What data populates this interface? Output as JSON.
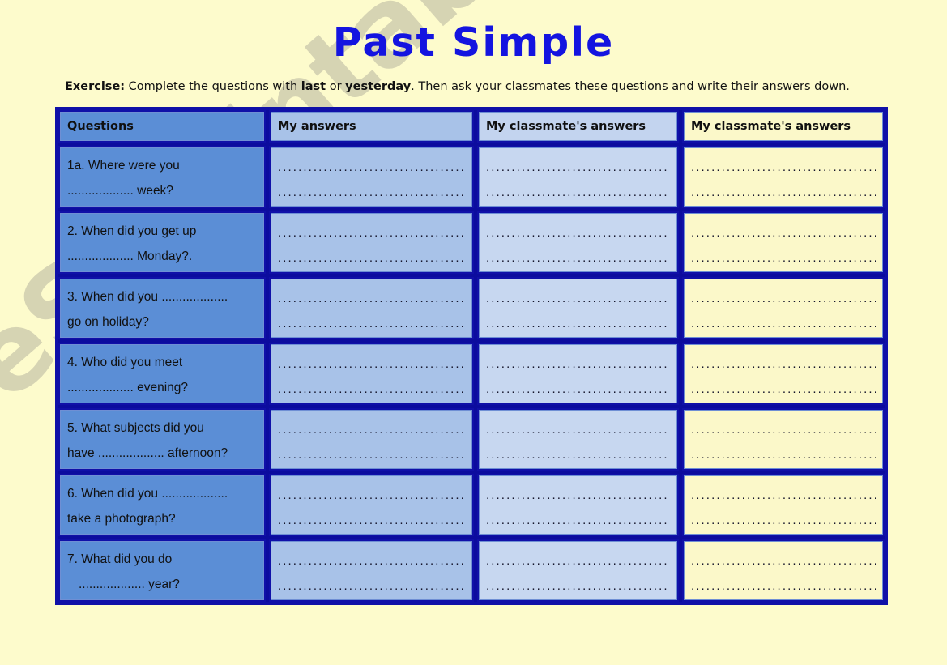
{
  "page": {
    "title": "Past Simple",
    "background_color": "#fdfbcc",
    "title_color": "#1414e0",
    "border_color": "#1010a8"
  },
  "instruction": {
    "label": "Exercise:",
    "part1": " Complete the questions with ",
    "bold1": "last",
    "part2": " or ",
    "bold2": "yesterday",
    "part3": ". Then ask your classmates these questions and write their answers down."
  },
  "watermark": {
    "text": "eSLprintables.com",
    "color": "#b8b5a0"
  },
  "table": {
    "headers": [
      "Questions",
      "My answers",
      "My classmate's answers",
      "My classmate's answers"
    ],
    "rows": [
      {
        "question_line1": "1a. Where were you",
        "question_line2": "................... week?",
        "answer1": [
          "...............................................",
          "..............................................."
        ],
        "answer2": [
          "...............................................",
          "..............................................."
        ],
        "answer3": [
          "...............................................",
          "..............................................."
        ]
      },
      {
        "question_line1": "2. When did you get up",
        "question_line2": "................... Monday?.",
        "answer1": [
          "...............................................",
          "..............................................."
        ],
        "answer2": [
          "...............................................",
          "..............................................."
        ],
        "answer3": [
          "...............................................",
          "..............................................."
        ]
      },
      {
        "question_line1": "3. When did you ...................",
        "question_line2": "go on holiday?",
        "answer1": [
          "...............................................",
          "..............................................."
        ],
        "answer2": [
          "...............................................",
          "..............................................."
        ],
        "answer3": [
          "...............................................",
          "..............................................."
        ]
      },
      {
        "question_line1": "4. Who did you meet",
        "question_line2": "................... evening?",
        "answer1": [
          "...............................................",
          "..............................................."
        ],
        "answer2": [
          "...............................................",
          "..............................................."
        ],
        "answer3": [
          "...............................................",
          "..............................................."
        ]
      },
      {
        "question_line1": "5. What subjects did you",
        "question_line2": "have ................... afternoon?",
        "answer1": [
          "...............................................",
          "..............................................."
        ],
        "answer2": [
          "...............................................",
          "..............................................."
        ],
        "answer3": [
          "...............................................",
          "..............................................."
        ]
      },
      {
        "question_line1": "6. When did you ...................",
        "question_line2": "take a photograph?",
        "answer1": [
          "...............................................",
          "..............................................."
        ],
        "answer2": [
          "...............................................",
          "..............................................."
        ],
        "answer3": [
          "...............................................",
          "..............................................."
        ]
      },
      {
        "question_line1": "7. What did you do",
        "question_line2": "................... year?",
        "answer1": [
          "...............................................",
          "..............................................."
        ],
        "answer2": [
          "...............................................",
          "..............................................."
        ],
        "answer3": [
          "...............................................",
          "..............................................."
        ]
      }
    ]
  }
}
